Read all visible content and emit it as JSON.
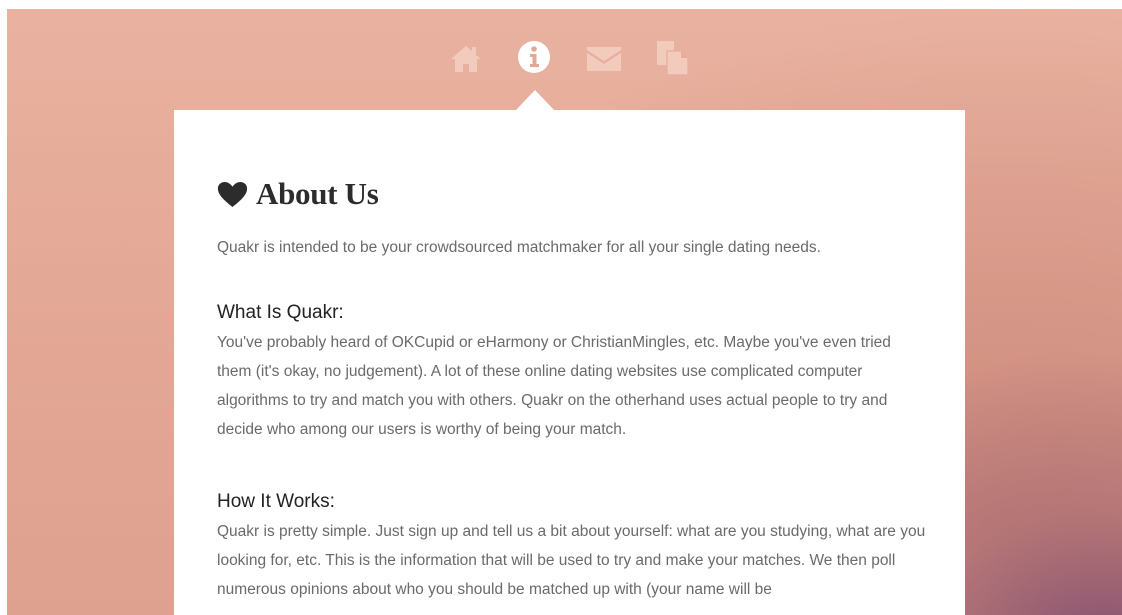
{
  "nav": {
    "items": [
      {
        "icon": "home-icon",
        "active": false
      },
      {
        "icon": "info-icon",
        "active": true
      },
      {
        "icon": "mail-icon",
        "active": false
      },
      {
        "icon": "documents-icon",
        "active": false
      }
    ]
  },
  "about": {
    "title": "About Us",
    "intro": "Quakr is intended to be your crowdsourced matchmaker for all your single dating needs.",
    "sections": [
      {
        "heading": "What Is Quakr:",
        "body": "You've probably heard of OKCupid or eHarmony or ChristianMingles, etc. Maybe you've even tried them (it's okay, no judgement). A lot of these online dating websites use complicated computer algorithms to try and match you with others. Quakr on the otherhand uses actual people to try and decide who among our users is worthy of being your match."
      },
      {
        "heading": "How It Works:",
        "body": "Quakr is pretty simple. Just sign up and tell us a bit about yourself: what are you studying, what are you looking for, etc. This is the information that will be used to try and make your matches. We then poll numerous opinions about who you should be matched up with (your name will be"
      }
    ]
  },
  "colors": {
    "background_top": "#e9b2a0",
    "background_corner": "#7a4a6e",
    "nav_inactive": "#f3cbbd",
    "nav_active": "#ffffff",
    "card": "#ffffff",
    "text_dark": "#2c2c2c",
    "text_muted": "#6a6a6a"
  }
}
